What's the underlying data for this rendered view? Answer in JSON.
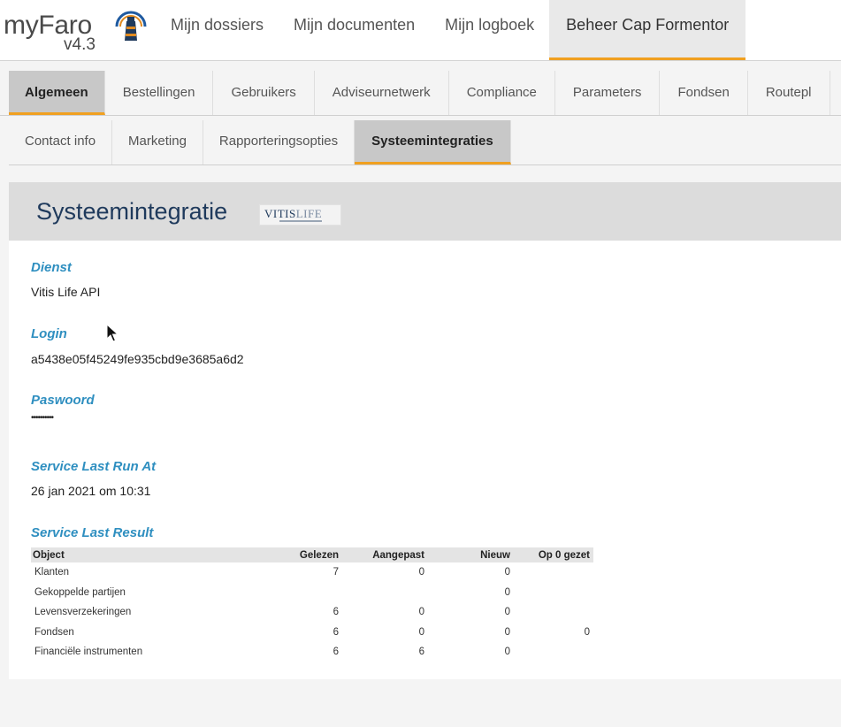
{
  "header": {
    "logo_text": "myFaro",
    "logo_version": "v4.3",
    "logo_icon": "lighthouse-icon",
    "nav": [
      {
        "label": "Mijn dossiers"
      },
      {
        "label": "Mijn documenten"
      },
      {
        "label": "Mijn logboek"
      },
      {
        "label": "Beheer Cap Formentor",
        "active": true
      }
    ]
  },
  "tabs": {
    "level1": [
      {
        "label": "Algemeen",
        "active": true
      },
      {
        "label": "Bestellingen"
      },
      {
        "label": "Gebruikers"
      },
      {
        "label": "Adviseurnetwerk"
      },
      {
        "label": "Compliance"
      },
      {
        "label": "Parameters"
      },
      {
        "label": "Fondsen"
      },
      {
        "label": "Routepl"
      }
    ],
    "level2": [
      {
        "label": "Contact info"
      },
      {
        "label": "Marketing"
      },
      {
        "label": "Rapporteringsopties"
      },
      {
        "label": "Systeemintegraties",
        "active": true
      }
    ]
  },
  "panel": {
    "title": "Systeemintegratie",
    "partner_logo": {
      "main": "VITIS",
      "light": "LIFE"
    },
    "fields": {
      "dienst": {
        "label": "Dienst",
        "value": "Vitis Life API"
      },
      "login": {
        "label": "Login",
        "value": "a5438e05f45249fe935cbd9e3685a6d2"
      },
      "paswoord": {
        "label": "Paswoord",
        "value": "••••••••••"
      },
      "last_run": {
        "label": "Service Last Run At",
        "value": "26 jan 2021 om 10:31"
      },
      "last_result": {
        "label": "Service Last Result"
      }
    },
    "result_table": {
      "headers": [
        "Object",
        "Gelezen",
        "Aangepast",
        "Nieuw",
        "Op 0 gezet"
      ],
      "rows": [
        [
          "Klanten",
          "7",
          "0",
          "0",
          ""
        ],
        [
          "Gekoppelde partijen",
          "",
          "",
          "0",
          ""
        ],
        [
          "Levensverzekeringen",
          "6",
          "0",
          "0",
          ""
        ],
        [
          "Fondsen",
          "6",
          "0",
          "0",
          "0"
        ],
        [
          "Financiële instrumenten",
          "6",
          "6",
          "0",
          ""
        ]
      ]
    }
  },
  "colors": {
    "accent": "#f0a020",
    "label_blue": "#2f8fc0",
    "title_navy": "#1f3a5c"
  }
}
